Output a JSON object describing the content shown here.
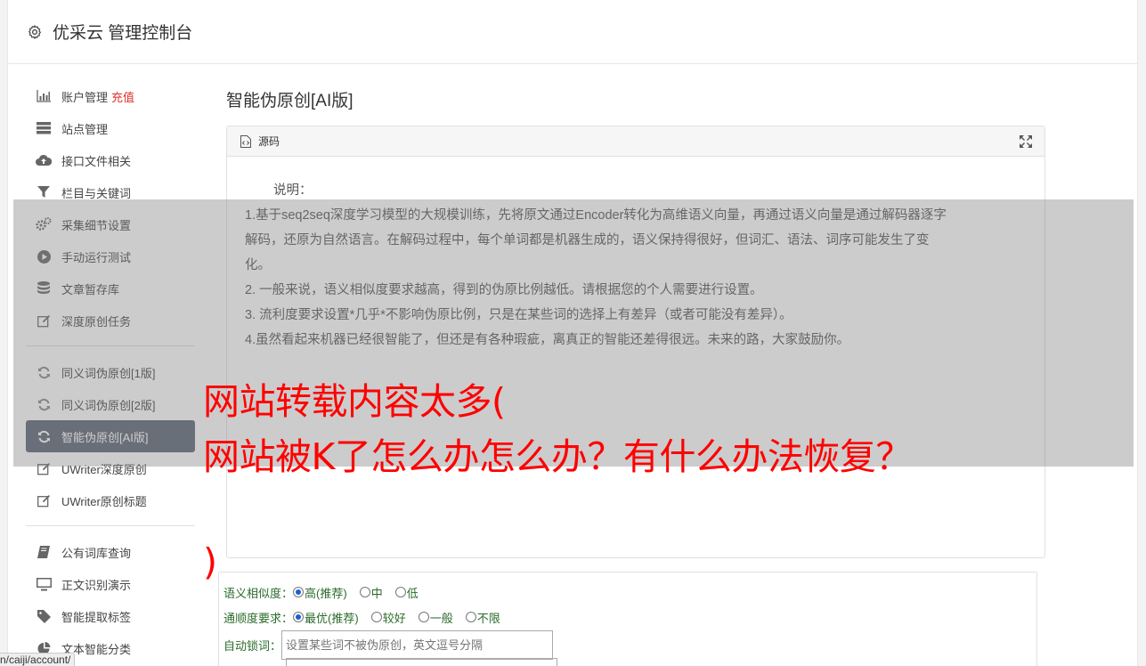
{
  "header": {
    "title": "优采云 管理控制台",
    "icon": "gear-icon"
  },
  "sidebar": {
    "group1": [
      {
        "label": "账户管理",
        "badge": "充值",
        "icon": "bar-chart-icon"
      },
      {
        "label": "站点管理",
        "icon": "server-icon"
      },
      {
        "label": "接口文件相关",
        "icon": "cloud-upload-icon"
      },
      {
        "label": "栏目与关键词",
        "icon": "filter-icon"
      },
      {
        "label": "采集细节设置",
        "icon": "cogs-icon"
      },
      {
        "label": "手动运行测试",
        "icon": "play-circle-icon"
      },
      {
        "label": "文章暂存库",
        "icon": "database-icon"
      },
      {
        "label": "深度原创任务",
        "icon": "edit-icon"
      }
    ],
    "group2": [
      {
        "label": "同义词伪原创[1版]",
        "icon": "refresh-icon"
      },
      {
        "label": "同义词伪原创[2版]",
        "icon": "refresh-icon"
      },
      {
        "label": "智能伪原创[AI版]",
        "icon": "refresh-icon",
        "active": true
      },
      {
        "label": "UWriter深度原创",
        "icon": "edit-icon"
      },
      {
        "label": "UWriter原创标题",
        "icon": "edit-icon"
      }
    ],
    "group3": [
      {
        "label": "公有词库查询",
        "icon": "book-icon"
      },
      {
        "label": "正文识别演示",
        "icon": "monitor-icon"
      },
      {
        "label": "智能提取标签",
        "icon": "tag-icon"
      },
      {
        "label": "文本智能分类",
        "icon": "pie-chart-icon"
      }
    ]
  },
  "main": {
    "page_title": "智能伪原创[AI版]",
    "panel": {
      "title": "源码",
      "intro": "说明：",
      "lines": [
        "1.基于seq2seq深度学习模型的大规模训练，先将原文通过Encoder转化为高维语义向量，再通过语义向量是通过解码器逐字",
        "解码，还原为自然语言。在解码过程中，每个单词都是机器生成的，语义保持得很好，但词汇、语法、词序可能发生了变",
        "化。",
        "2. 一般来说，语义相似度要求越高，得到的伪原比例越低。请根据您的个人需要进行设置。",
        "3. 流利度要求设置*几乎*不影响伪原比例，只是在某些词的选择上有差异（或者可能没有差异）。",
        "4.虽然看起来机器已经很智能了，但还是有各种瑕疵，离真正的智能还差得很远。未来的路，大家鼓励你。"
      ]
    },
    "form": {
      "similarity": {
        "label": "语义相似度：",
        "options": [
          "高(推荐)",
          "中",
          "低"
        ],
        "selected": "高(推荐)"
      },
      "fluency": {
        "label": "通顺度要求：",
        "options": [
          "最优(推荐)",
          "较好",
          "一般",
          "不限"
        ],
        "selected": "最优(推荐)"
      },
      "lock": {
        "label": "自动锁词：",
        "placeholder": "设置某些词不被伪原创，英文逗号分隔"
      }
    }
  },
  "overlay": {
    "headline_line1": "网站转载内容太多(",
    "headline_line2": "网站被K了怎么办怎么办？有什么办法恢复？",
    "headline_line3": ")"
  },
  "statusbar": {
    "url": "n/caiji/account/"
  }
}
